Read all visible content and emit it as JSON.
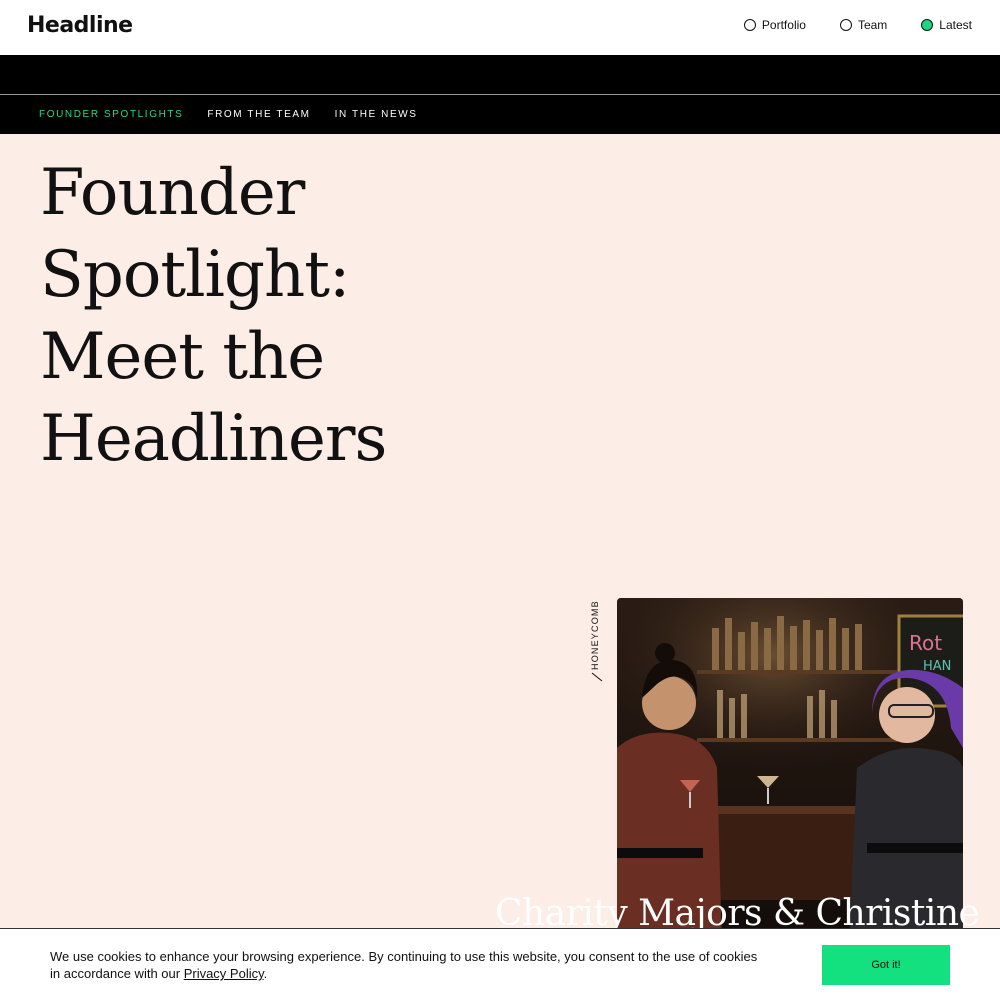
{
  "header": {
    "logo": "Headline",
    "nav": [
      {
        "label": "Portfolio",
        "active": false
      },
      {
        "label": "Team",
        "active": false
      },
      {
        "label": "Latest",
        "active": true
      }
    ]
  },
  "subnav": {
    "items": [
      {
        "label": "FOUNDER SPOTLIGHTS",
        "active": true
      },
      {
        "label": "FROM THE TEAM",
        "active": false
      },
      {
        "label": "IN THE NEWS",
        "active": false
      }
    ]
  },
  "hero": {
    "title_lines": [
      "Founder",
      "Spotlight:",
      "Meet the",
      "Headliners"
    ]
  },
  "feature": {
    "company_label": "HONEYCOMB",
    "caption": "Charity Majors & Christine"
  },
  "cookie": {
    "text": "We use cookies to enhance your browsing experience. By continuing to use this website, you consent to the use of cookies in accordance with our ",
    "link": "Privacy Policy",
    "after": ".",
    "button": "Got it!"
  },
  "colors": {
    "accent_green": "#1ed67e",
    "page_bg": "#fcede6",
    "nav_bg": "#000000"
  },
  "icons": [
    "radio-empty-icon",
    "radio-filled-icon",
    "slash-icon"
  ]
}
